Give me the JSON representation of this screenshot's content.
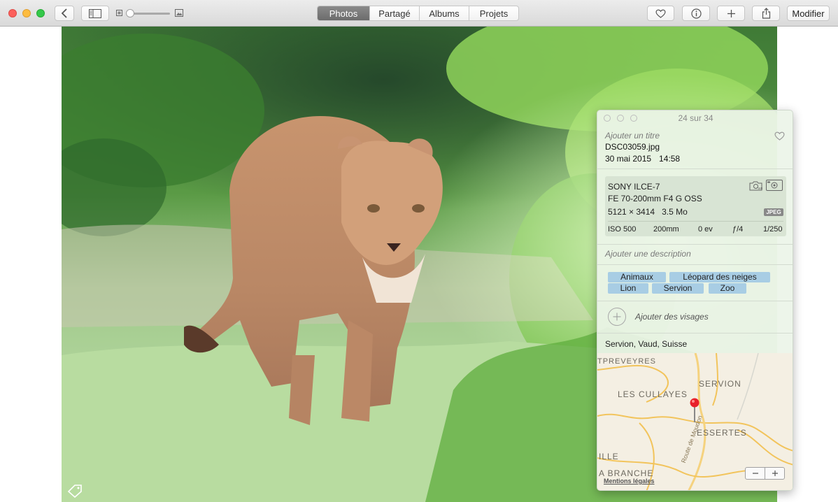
{
  "window": {
    "traffic_lights": [
      "close",
      "minimize",
      "zoom"
    ]
  },
  "toolbar": {
    "tabs": [
      {
        "label": "Photos",
        "active": true
      },
      {
        "label": "Partagé",
        "active": false
      },
      {
        "label": "Albums",
        "active": false
      },
      {
        "label": "Projets",
        "active": false
      }
    ],
    "edit_label": "Modifier",
    "zoom_slider_level": 0.0
  },
  "info": {
    "counter": "24 sur 34",
    "title_placeholder": "Ajouter un titre",
    "filename": "DSC03059.jpg",
    "date": "30 mai 2015",
    "time": "14:58",
    "camera": {
      "model": "SONY ILCE-7",
      "lens": "FE 70-200mm F4 G OSS",
      "dimensions": "5121 × 3414",
      "size": "3.5 Mo",
      "format": "JPEG",
      "iso": "ISO 500",
      "focal": "200mm",
      "ev": "0 ev",
      "aperture": "ƒ/4",
      "shutter": "1/250"
    },
    "description_placeholder": "Ajouter une description",
    "keywords": [
      "Animaux",
      "Léopard des neiges",
      "Lion",
      "Servion",
      "Zoo"
    ],
    "faces_label": "Ajouter des visages",
    "location": "Servion, Vaud, Suisse",
    "map": {
      "places": [
        "TPREVEYRES",
        "SERVION",
        "LES CULLAYES",
        "ESSERTES",
        "ILLE",
        "A BRANCHE"
      ],
      "road": "Route de Moudon",
      "legal": "Mentions légales"
    }
  },
  "colors": {
    "accent_tag": "#a8cde4",
    "tab_active": "#7b7b7b",
    "close": "#fc605c",
    "minimize": "#fdbc40",
    "zoom": "#34c84a"
  },
  "icons": [
    "back-icon",
    "sidebar-icon",
    "small-photo-icon",
    "large-photo-icon",
    "heart-icon",
    "info-icon",
    "plus-icon",
    "share-icon",
    "tag-icon",
    "camera-wb-icon",
    "exposure-icon",
    "map-pin-icon"
  ]
}
